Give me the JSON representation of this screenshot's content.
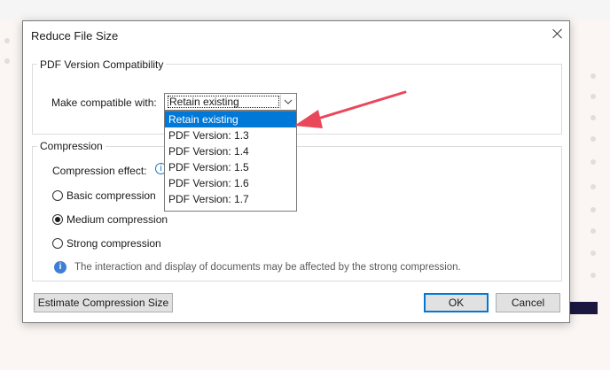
{
  "dialog": {
    "title": "Reduce File Size"
  },
  "pdf_version": {
    "legend": "PDF Version Compatibility",
    "make_compatible_label": "Make compatible with:",
    "selected": "Retain existing",
    "options": [
      "Retain existing",
      "PDF Version: 1.3",
      "PDF Version: 1.4",
      "PDF Version: 1.5",
      "PDF Version: 1.6",
      "PDF Version: 1.7"
    ]
  },
  "compression": {
    "legend": "Compression",
    "effect_label": "Compression effect:",
    "options": [
      {
        "label": "Basic compression",
        "selected": false
      },
      {
        "label": "Medium compression",
        "selected": true
      },
      {
        "label": "Strong compression",
        "selected": false
      }
    ],
    "note": "The interaction and display of documents may be affected by the strong compression."
  },
  "buttons": {
    "estimate": "Estimate Compression Size",
    "ok": "OK",
    "cancel": "Cancel"
  },
  "icons": {
    "info": "i"
  },
  "colors": {
    "selection": "#0078d7",
    "annotation_arrow": "#e8485a",
    "info_icon": "#3d7fd4"
  }
}
